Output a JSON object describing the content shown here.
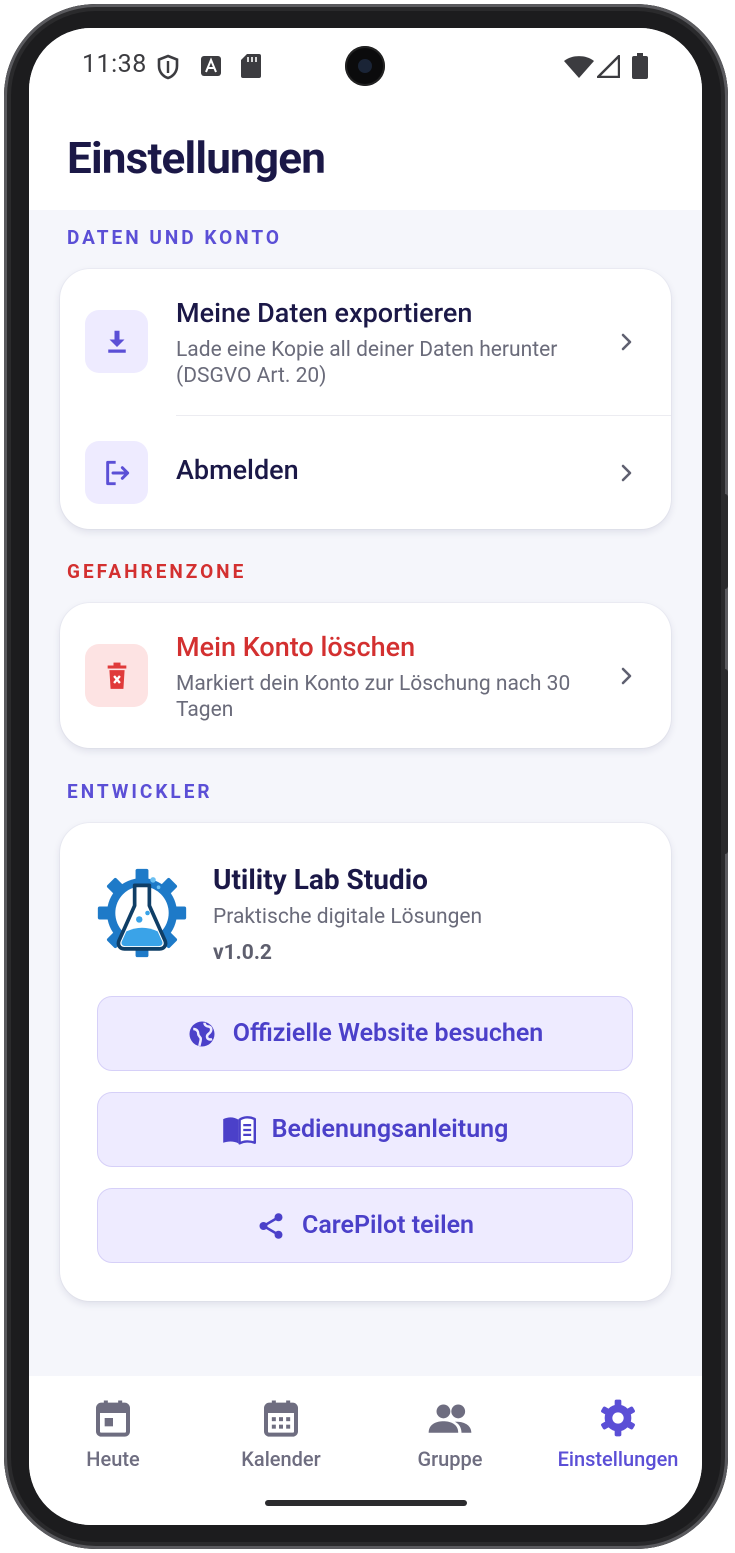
{
  "status_bar": {
    "time": "11:38"
  },
  "header": {
    "title": "Einstellungen"
  },
  "sections": {
    "data_account": {
      "label": "DATEN UND KONTO",
      "export": {
        "title": "Meine Daten exportieren",
        "subtitle": "Lade eine Kopie all deiner Daten herunter (DSGVO Art. 20)"
      },
      "logout": {
        "title": "Abmelden"
      }
    },
    "danger": {
      "label": "GEFAHRENZONE",
      "delete": {
        "title": "Mein Konto löschen",
        "subtitle": "Markiert dein Konto zur Löschung nach 30 Tagen"
      }
    },
    "developer": {
      "label": "ENTWICKLER",
      "name": "Utility Lab Studio",
      "tagline": "Praktische digitale Lösungen",
      "version": "v1.0.2",
      "buttons": {
        "website": "Offizielle Website besuchen",
        "manual": "Bedienungsanleitung",
        "share": "CarePilot teilen"
      }
    }
  },
  "nav": {
    "items": [
      {
        "label": "Heute",
        "icon": "calendar-today-icon"
      },
      {
        "label": "Kalender",
        "icon": "calendar-month-icon"
      },
      {
        "label": "Gruppe",
        "icon": "group-icon"
      },
      {
        "label": "Einstellungen",
        "icon": "gear-icon"
      }
    ],
    "active": "Einstellungen"
  },
  "colors": {
    "accent": "#5b4fd6",
    "danger": "#d33030",
    "title": "#1b1847",
    "background": "#f5f6fb"
  }
}
